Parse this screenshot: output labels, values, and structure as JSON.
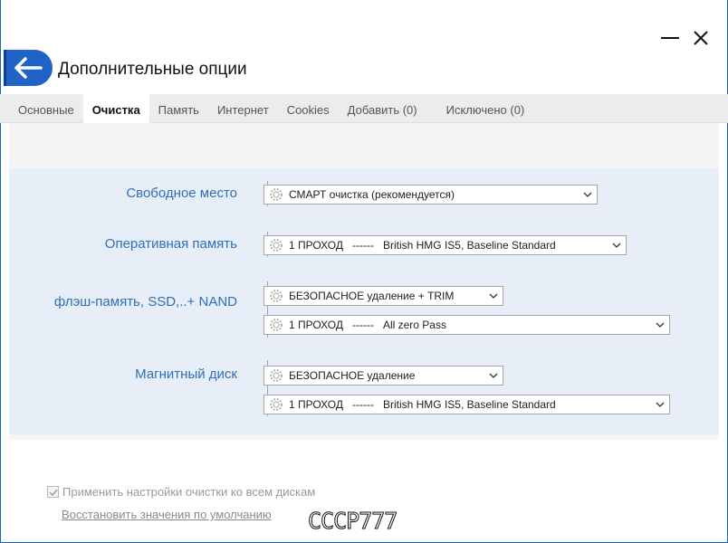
{
  "window": {
    "title": "Дополнительные опции"
  },
  "tabs": [
    {
      "label": "Основные"
    },
    {
      "label": "Очистка"
    },
    {
      "label": "Память"
    },
    {
      "label": "Интернет"
    },
    {
      "label": "Cookies"
    },
    {
      "label": "Добавить (0)"
    },
    {
      "label": "Исключено (0)"
    }
  ],
  "active_tab": "Очистка",
  "sections": {
    "free_space": {
      "label": "Свободное место",
      "select": "СМАРТ очистка (рекомендуется)"
    },
    "ram": {
      "label": "Оперативная память",
      "select": "1 ПРОХОД   ------   British HMG IS5, Baseline Standard"
    },
    "flash": {
      "label": "флэш-память, SSD,..+ NAND",
      "select_method": "БЕЗОПАСНОЕ удаление + TRIM",
      "select_pass": "1 ПРОХОД   ------   All zero Pass"
    },
    "magnetic": {
      "label": "Магнитный диск",
      "select_method": "БЕЗОПАСНОЕ удаление",
      "select_pass": "1 ПРОХОД   ------   British HMG IS5, Baseline Standard"
    }
  },
  "footer": {
    "apply_all_label": "Применить настройки очистки ко всем дискам",
    "apply_all_checked": true,
    "restore_defaults": "Восстановить значения по умолчанию"
  },
  "watermark_text": "СССР777",
  "colors": {
    "accent": "#1f63c6",
    "label_blue": "#2e6fb8",
    "panel_bg": "#e7eef8",
    "tab_bar": "#ececec"
  },
  "icons": [
    "minimize-icon",
    "close-icon",
    "back-arrow-icon",
    "gear-icon",
    "chevron-down-icon",
    "checkmark-icon"
  ]
}
